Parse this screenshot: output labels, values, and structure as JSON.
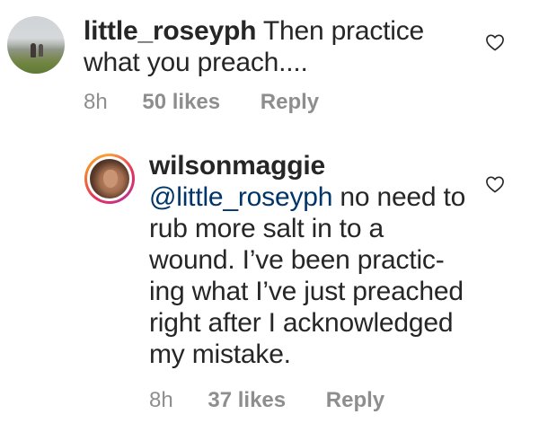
{
  "comments": [
    {
      "username": "little_roseyph",
      "text": "Then practice what you preach....",
      "time": "8h",
      "likes": "50 likes",
      "reply_label": "Reply",
      "avatar_icon": "profile-photo-landscape"
    }
  ],
  "reply": {
    "username": "wilsonmaggie",
    "mention": "@little_roseyph",
    "text": " no need to rub more salt in to a wound. I’ve been practic-ing what I’ve just preached right after I acknowledged my mistake.",
    "time": "8h",
    "likes": "37 likes",
    "reply_label": "Reply",
    "avatar_icon": "profile-photo-story-ring"
  },
  "icons": {
    "like": "heart-outline-icon"
  },
  "colors": {
    "text": "#262626",
    "meta": "#8e8e8e",
    "mention": "#003569",
    "story_ring_start": "#f9a13a",
    "story_ring_end": "#c2338e"
  }
}
